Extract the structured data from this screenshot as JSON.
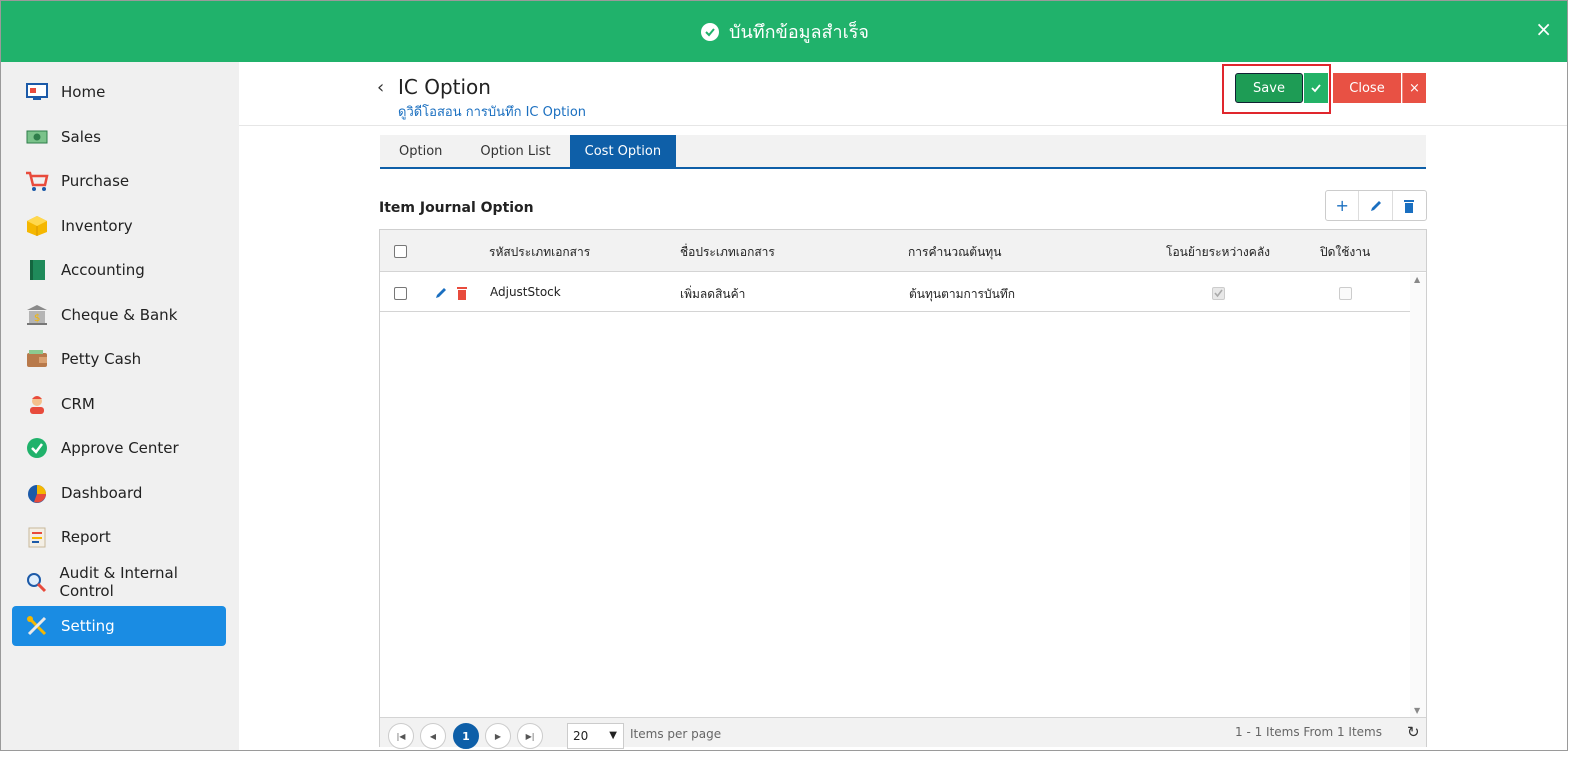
{
  "toast": {
    "message": "บันทึกข้อมูลสำเร็จ",
    "close": "×",
    "color": "#20b26b"
  },
  "sidebar": {
    "items": [
      {
        "label": "Home",
        "icon": "home-icon"
      },
      {
        "label": "Sales",
        "icon": "money-icon"
      },
      {
        "label": "Purchase",
        "icon": "cart-icon"
      },
      {
        "label": "Inventory",
        "icon": "box-icon"
      },
      {
        "label": "Accounting",
        "icon": "book-icon"
      },
      {
        "label": "Cheque & Bank",
        "icon": "bank-icon"
      },
      {
        "label": "Petty Cash",
        "icon": "wallet-icon"
      },
      {
        "label": "CRM",
        "icon": "person-icon"
      },
      {
        "label": "Approve Center",
        "icon": "check-circle-icon"
      },
      {
        "label": "Dashboard",
        "icon": "pie-chart-icon"
      },
      {
        "label": "Report",
        "icon": "report-icon"
      },
      {
        "label": "Audit & Internal Control",
        "icon": "magnifier-icon"
      },
      {
        "label": "Setting",
        "icon": "tools-icon",
        "active": true
      }
    ],
    "active_color": "#1a8ce3"
  },
  "header": {
    "title": "IC Option",
    "subtitle": "ดูวิดีโอสอน การบันทึก IC Option",
    "save_label": "Save",
    "close_label": "Close"
  },
  "tabs": [
    {
      "label": "Option"
    },
    {
      "label": "Option List"
    },
    {
      "label": "Cost Option",
      "active": true
    }
  ],
  "section": {
    "title": "Item Journal Option"
  },
  "grid": {
    "columns": [
      "รหัสประเภทเอกสาร",
      "ชื่อประเภทเอกสาร",
      "การคำนวณต้นทุน",
      "โอนย้ายระหว่างคลัง",
      "ปิดใช้งาน"
    ],
    "rows": [
      {
        "code": "AdjustStock",
        "name": "เพิ่มลดสินค้า",
        "cost_calc": "ต้นทุนตามการบันทึก",
        "transfer": true,
        "disabled": false
      }
    ]
  },
  "pager": {
    "page": "1",
    "page_size": "20",
    "items_per_page_label": "Items per page",
    "summary": "1 - 1 Items From 1 Items"
  }
}
